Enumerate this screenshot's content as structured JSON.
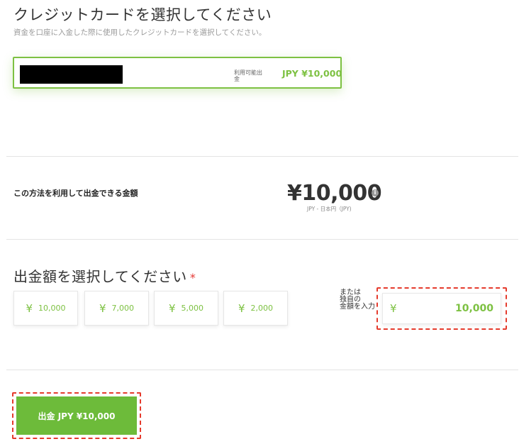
{
  "card_section": {
    "title": "クレジットカードを選択してください",
    "subtitle": "資金を口座に入金した際に使用したクレジットカードを選択してください。",
    "card": {
      "available_label": "利用可能出金",
      "amount": "JPY ¥10,000"
    }
  },
  "withdrawable": {
    "label": "この方法を利用して出金できる金額",
    "amount": "¥10,000",
    "info_icon": "info-icon",
    "currency_caption": "JPY - 日本円（JPY)"
  },
  "amount_section": {
    "title": "出金額を選択してください",
    "required_mark": "*",
    "currency_symbol": "¥",
    "presets": [
      {
        "value": "10,000"
      },
      {
        "value": "7,000"
      },
      {
        "value": "5,000"
      },
      {
        "value": "2,000"
      }
    ],
    "custom": {
      "label_lines": [
        "または",
        "独自の",
        "金額を入力"
      ],
      "value": "10,000"
    }
  },
  "submit": {
    "label": "出金 JPY ¥10,000"
  },
  "colors": {
    "accent": "#7dc142",
    "button": "#6dbb3a",
    "highlight_dashed": "#e53b2d",
    "required": "#e53935"
  }
}
